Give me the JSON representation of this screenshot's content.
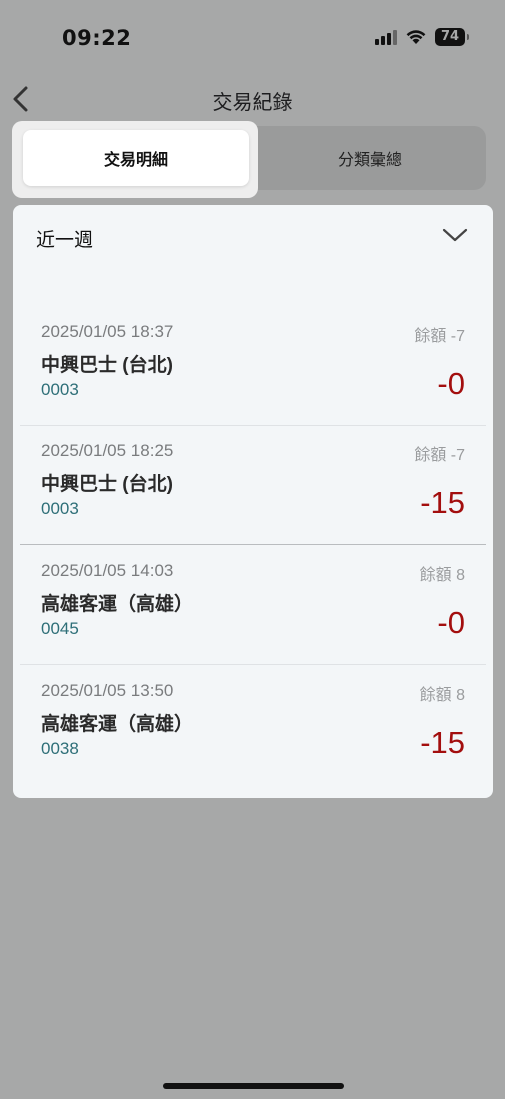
{
  "status_bar": {
    "time": "09:22",
    "battery": "74"
  },
  "header": {
    "title": "交易紀錄",
    "back_icon": "chevron-left-icon"
  },
  "tabs": [
    {
      "label": "交易明細",
      "active": true
    },
    {
      "label": "分類彙總",
      "active": false
    }
  ],
  "filter": {
    "period": "近一週",
    "icon": "chevron-down-icon"
  },
  "transactions": [
    {
      "datetime": "2025/01/05 18:37",
      "merchant": "中興巴士 (台北)",
      "code": "0003",
      "balance": "餘額 -7",
      "amount": "-0"
    },
    {
      "datetime": "2025/01/05 18:25",
      "merchant": "中興巴士 (台北)",
      "code": "0003",
      "balance": "餘額 -7",
      "amount": "-15"
    },
    {
      "datetime": "2025/01/05 14:03",
      "merchant": "高雄客運（高雄）",
      "code": "0045",
      "balance": "餘額 8",
      "amount": "-0"
    },
    {
      "datetime": "2025/01/05 13:50",
      "merchant": "高雄客運（高雄）",
      "code": "0038",
      "balance": "餘額 8",
      "amount": "-15"
    }
  ],
  "colors": {
    "background": "#a7a8a8",
    "card": "#f3f6f8",
    "amount": "#a30e0e",
    "code": "#2e6f78"
  }
}
